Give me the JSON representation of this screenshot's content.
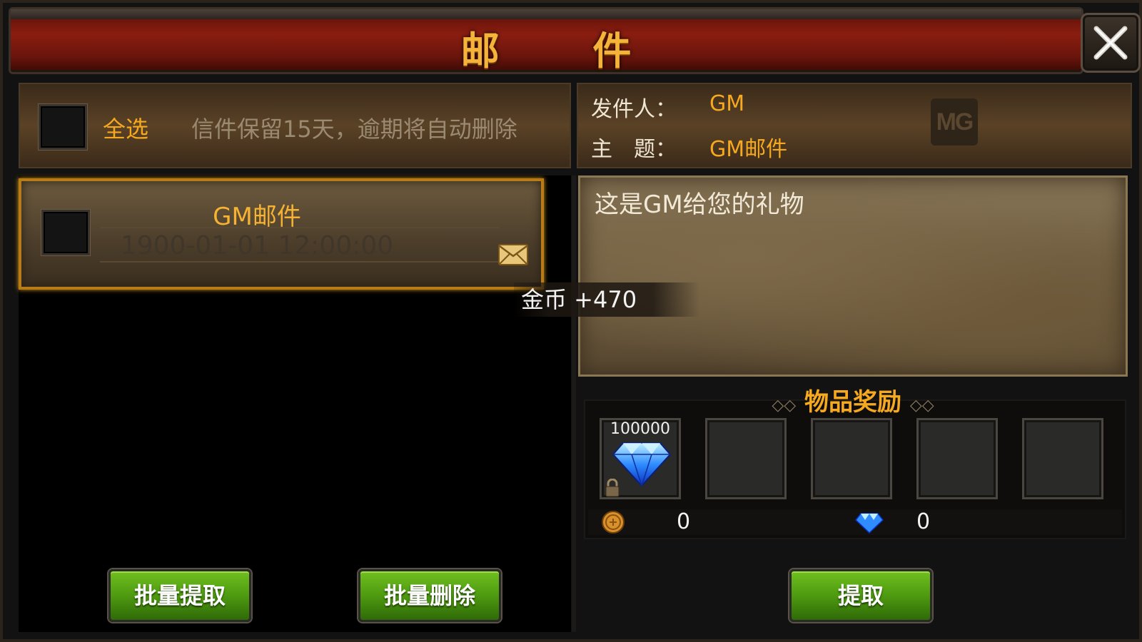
{
  "window": {
    "title": "邮 件"
  },
  "list_header": {
    "select_all_label": "全选",
    "retention_note": "信件保留15天，逾期将自动删除"
  },
  "mail_detail": {
    "sender_label": "发件人：",
    "sender_value": "GM",
    "subject_label": "主　题：",
    "subject_value": "GM邮件",
    "logo_text": "MG",
    "body_text": "这是GM给您的礼物"
  },
  "mail_list": [
    {
      "subject": "GM邮件",
      "date": "1900-01-01 12:00:00",
      "icon": "envelope-icon"
    }
  ],
  "toast": {
    "text": "金币 +470"
  },
  "rewards": {
    "title": "物品奖励",
    "slots": [
      {
        "item": "diamond-icon",
        "count": "100000",
        "locked": true
      },
      {
        "item": null
      },
      {
        "item": null
      },
      {
        "item": null
      },
      {
        "item": null
      }
    ],
    "gold_value": "0",
    "diamond_value": "0"
  },
  "buttons": {
    "batch_claim": "批量提取",
    "batch_delete": "批量删除",
    "claim": "提取"
  },
  "colors": {
    "accent_gold": "#f6a91e",
    "title_red": "#8a1d10",
    "button_green": "#4e9a10",
    "selected_border": "#b77b18"
  }
}
